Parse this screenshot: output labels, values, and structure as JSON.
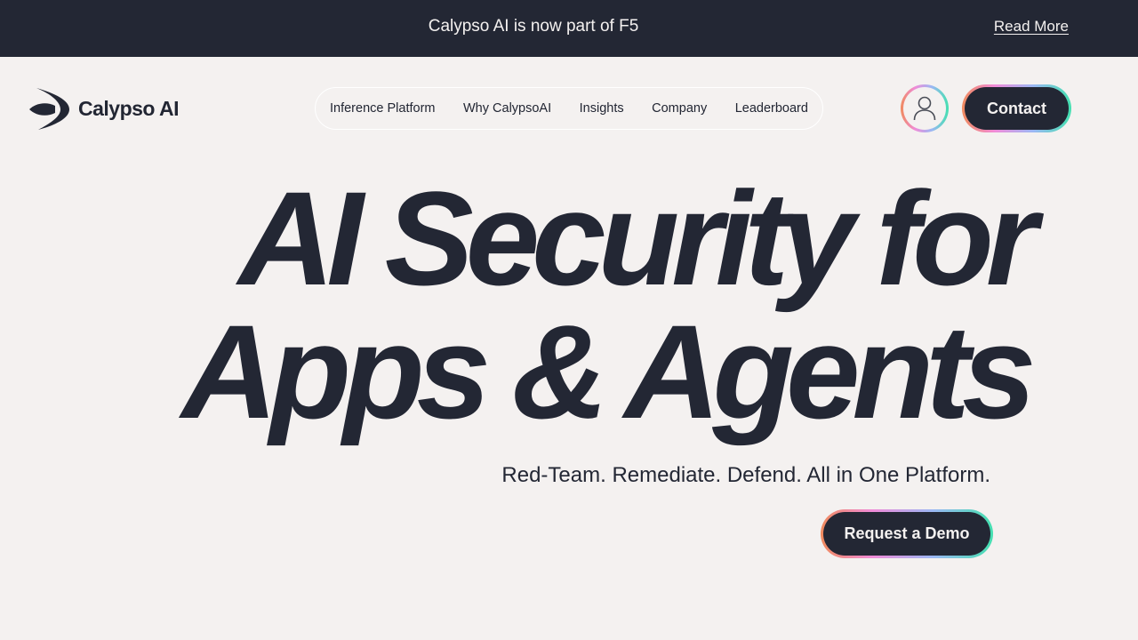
{
  "announcement": {
    "text": "Calypso AI is now part of F5",
    "link_label": "Read More"
  },
  "header": {
    "logo_text": "Calypso AI",
    "nav": [
      {
        "label": "Inference Platform"
      },
      {
        "label": "Why CalypsoAI"
      },
      {
        "label": "Insights"
      },
      {
        "label": "Company"
      },
      {
        "label": "Leaderboard"
      }
    ],
    "contact_label": "Contact",
    "account_icon": "user-icon"
  },
  "hero": {
    "title_line1": "AI Security for",
    "title_line2": "Apps & Agents",
    "tagline": "Red-Team. Remediate. Defend. All in One Platform.",
    "cta_label": "Request a Demo"
  },
  "colors": {
    "background": "#f4f1f0",
    "dark": "#232734",
    "gradient_start": "#f08a5d",
    "gradient_mid": "#f08bd8",
    "gradient_end": "#44e0b0"
  }
}
